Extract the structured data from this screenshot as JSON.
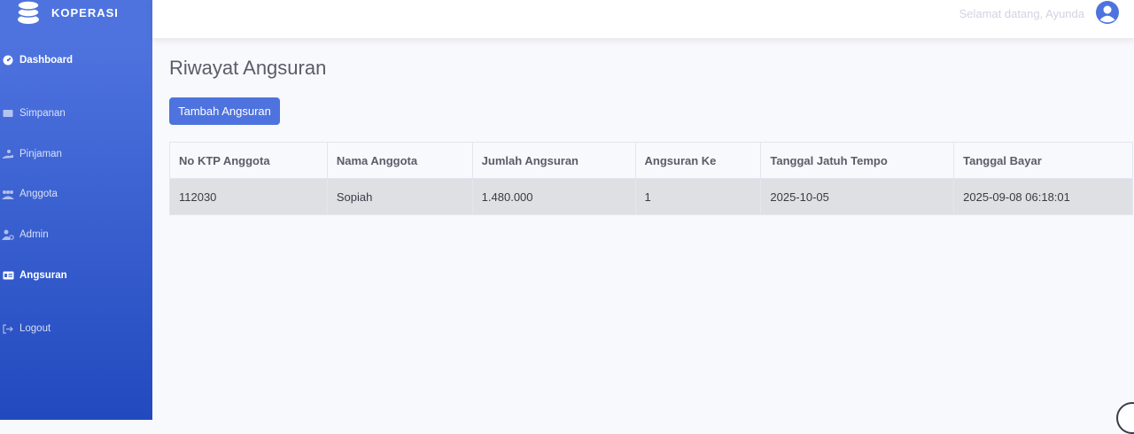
{
  "brand": {
    "name": "KOPERASI",
    "icon": "coins-icon"
  },
  "sidebar": {
    "items": [
      {
        "label": "Dashboard",
        "icon": "tachometer-icon",
        "active": true
      },
      {
        "label": "Simpanan",
        "icon": "wallet-icon",
        "active": false
      },
      {
        "label": "Pinjaman",
        "icon": "hand-holding-icon",
        "active": false
      },
      {
        "label": "Anggota",
        "icon": "users-icon",
        "active": false
      },
      {
        "label": "Admin",
        "icon": "user-cog-icon",
        "active": false
      },
      {
        "label": "Angsuran",
        "icon": "id-card-icon",
        "active": true
      },
      {
        "label": "Logout",
        "icon": "sign-out-icon",
        "active": false
      }
    ]
  },
  "topbar": {
    "greeting": "Selamat datang, Ayunda",
    "avatar_icon": "user-circle-icon"
  },
  "main": {
    "title": "Riwayat Angsuran",
    "add_button_label": "Tambah Angsuran"
  },
  "table": {
    "columns": [
      "No KTP Anggota",
      "Nama Anggota",
      "Jumlah Angsuran",
      "Angsuran Ke",
      "Tanggal Jatuh Tempo",
      "Tanggal Bayar"
    ],
    "rows": [
      [
        "112030",
        "Sopiah",
        "1.480.000",
        "1",
        "2025-10-05",
        "2025-09-08 06:18:01"
      ]
    ]
  },
  "colors": {
    "sidebar_top": "#4e73df",
    "sidebar_bottom": "#224abe",
    "primary": "#4e73df",
    "row_bg": "#dfe0e4"
  }
}
